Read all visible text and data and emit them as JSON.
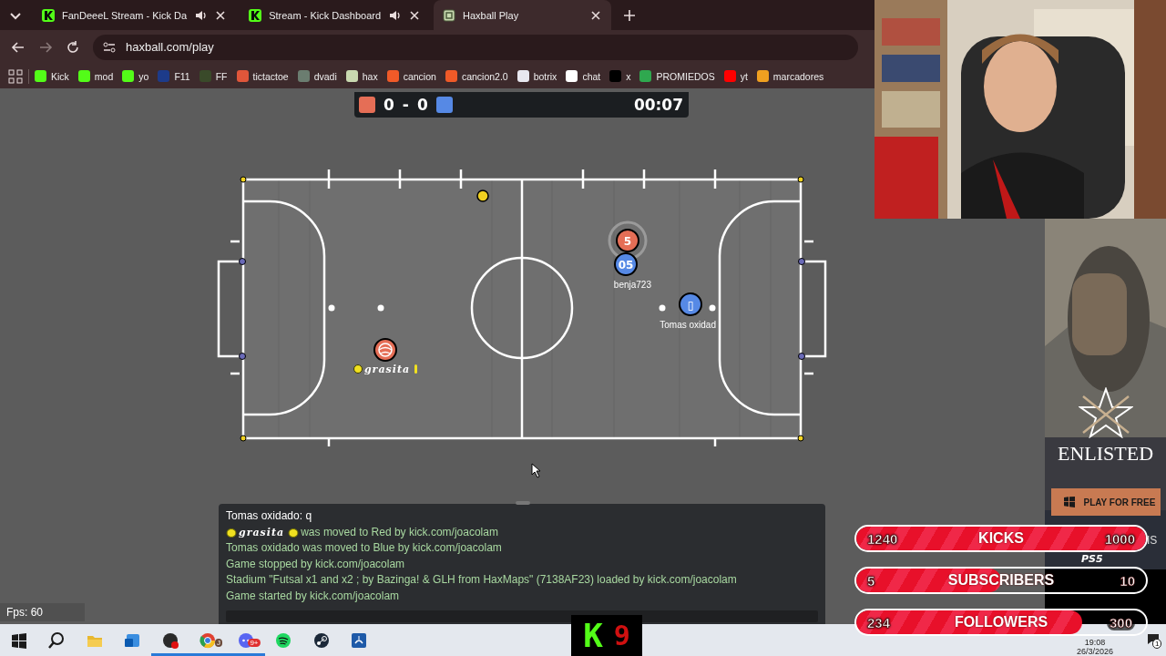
{
  "tabs": [
    {
      "title": "FanDeeeL Stream - Kick Da",
      "audio": true,
      "selected": false
    },
    {
      "title": "Stream - Kick Dashboard",
      "audio": true,
      "selected": false
    },
    {
      "title": "Haxball Play",
      "audio": false,
      "selected": true
    }
  ],
  "address": {
    "url": "haxball.com/play"
  },
  "bookmarks": [
    {
      "label": "Kick",
      "color": "#53fc18"
    },
    {
      "label": "mod",
      "color": "#53fc18"
    },
    {
      "label": "yo",
      "color": "#53fc18"
    },
    {
      "label": "F11",
      "color": "#1d3b8a"
    },
    {
      "label": "FF",
      "color": "#3a4a2a"
    },
    {
      "label": "tictactoe",
      "color": "#e0563a"
    },
    {
      "label": "dvadi",
      "color": "#6b7d70"
    },
    {
      "label": "hax",
      "color": "#c9d9b0"
    },
    {
      "label": "cancion",
      "color": "#f05a28"
    },
    {
      "label": "cancion2.0",
      "color": "#f05a28"
    },
    {
      "label": "botrix",
      "color": "#e8e8f0"
    },
    {
      "label": "chat",
      "color": "#ffffff"
    },
    {
      "label": "x",
      "color": "#000000"
    },
    {
      "label": "PROMIEDOS",
      "color": "#2fa84f"
    },
    {
      "label": "yt",
      "color": "#ff0000"
    },
    {
      "label": "marcadores",
      "color": "#f0a020"
    }
  ],
  "scoreboard": {
    "teams": [
      {
        "color": "#e56e56",
        "score": "0"
      },
      {
        "color": "#5689e5",
        "score": "0"
      }
    ],
    "separator": "-",
    "time": "00:07"
  },
  "players": [
    {
      "color": "#e56e56",
      "avatar": "5",
      "ring": true
    },
    {
      "color": "#5689e5",
      "avatar": "05",
      "name": "benja723",
      "ring": false
    },
    {
      "color": "#5689e5",
      "avatar": "▯",
      "name": "Tomas oxidad",
      "ring": false
    },
    {
      "color": "#e56e56",
      "kind": "icon",
      "name": "grasita",
      "ring": false
    }
  ],
  "chat": [
    {
      "kind": "chat",
      "text": "Tomas oxidado: q"
    },
    {
      "kind": "notice",
      "player": "grasita",
      "text": "was moved to Red by kick.com/joacolam"
    },
    {
      "kind": "notice",
      "text": "Tomas oxidado was moved to Blue by kick.com/joacolam"
    },
    {
      "kind": "notice",
      "text": "Game stopped by kick.com/joacolam"
    },
    {
      "kind": "notice",
      "text": "Stadium \"Futsal x1 and x2 ; by Bazinga! & GLH from HaxMaps\" (7138AF23) loaded by kick.com/joacolam"
    },
    {
      "kind": "notice",
      "text": "Game started by kick.com/joacolam"
    }
  ],
  "fps": "Fps: 60",
  "ad": {
    "title": "ENLISTED",
    "button": "PLAY FOR FREE",
    "text_cut": "IS",
    "platform": "PS5"
  },
  "goals": [
    {
      "current": "1240",
      "label": "KICKS",
      "target": "1000",
      "level": 1
    },
    {
      "current": "5",
      "label": "SUBSCRIBERS",
      "target": "10",
      "level": 0.5
    },
    {
      "current": "234",
      "label": "FOLLOWERS",
      "target": "300",
      "level": 0.78
    }
  ],
  "counter": {
    "letter": "K",
    "value": "9"
  },
  "taskbar": {
    "apps": [
      {
        "kind": "windows",
        "active": false
      },
      {
        "kind": "search",
        "active": false
      },
      {
        "kind": "folder",
        "active": false
      },
      {
        "kind": "mail",
        "active": false
      },
      {
        "kind": "record",
        "active": true
      },
      {
        "kind": "browser",
        "active": true,
        "badge": "J"
      },
      {
        "kind": "chat",
        "active": true,
        "badge": "9+"
      },
      {
        "kind": "music",
        "active": false
      },
      {
        "kind": "steam",
        "active": false
      },
      {
        "kind": "controller",
        "active": false
      }
    ],
    "time": "19:08",
    "date": "26/3/2026",
    "notifications": "1"
  }
}
